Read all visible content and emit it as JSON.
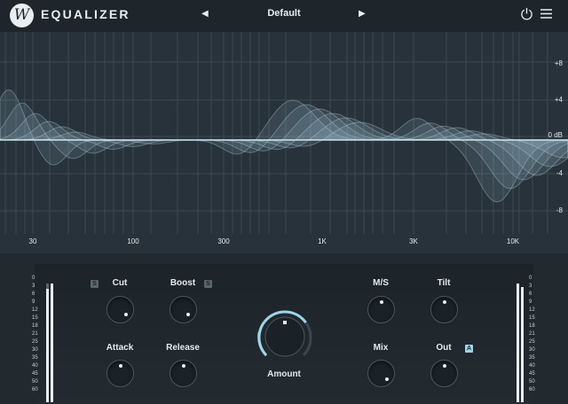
{
  "app": {
    "title": "EQUALIZER",
    "logo_letter": "W"
  },
  "header": {
    "preset_name": "Default",
    "prev_arrow": "◀",
    "next_arrow": "▶",
    "icons": [
      "power-icon",
      "menu-icon"
    ]
  },
  "graph": {
    "db_labels": [
      "+8",
      "+4",
      "0 dB",
      "-4",
      "-8"
    ],
    "freq_labels": [
      "30",
      "100",
      "300",
      "1K",
      "3K",
      "10K"
    ]
  },
  "meters": {
    "scale": [
      "0",
      "3",
      "6",
      "9",
      "12",
      "15",
      "18",
      "21",
      "25",
      "30",
      "35",
      "40",
      "45",
      "50",
      "60"
    ]
  },
  "controls": {
    "cut": {
      "label": "Cut",
      "badge": "S"
    },
    "boost": {
      "label": "Boost",
      "badge": "S"
    },
    "attack": {
      "label": "Attack"
    },
    "release": {
      "label": "Release"
    },
    "amount": {
      "label": "Amount"
    },
    "ms": {
      "label": "M/S"
    },
    "tilt": {
      "label": "Tilt"
    },
    "mix": {
      "label": "Mix"
    },
    "out": {
      "label": "Out",
      "badge": "A"
    }
  },
  "colors": {
    "accent": "#9fd3e6",
    "background": "#1d2429",
    "graph_bg": "#28323a"
  }
}
